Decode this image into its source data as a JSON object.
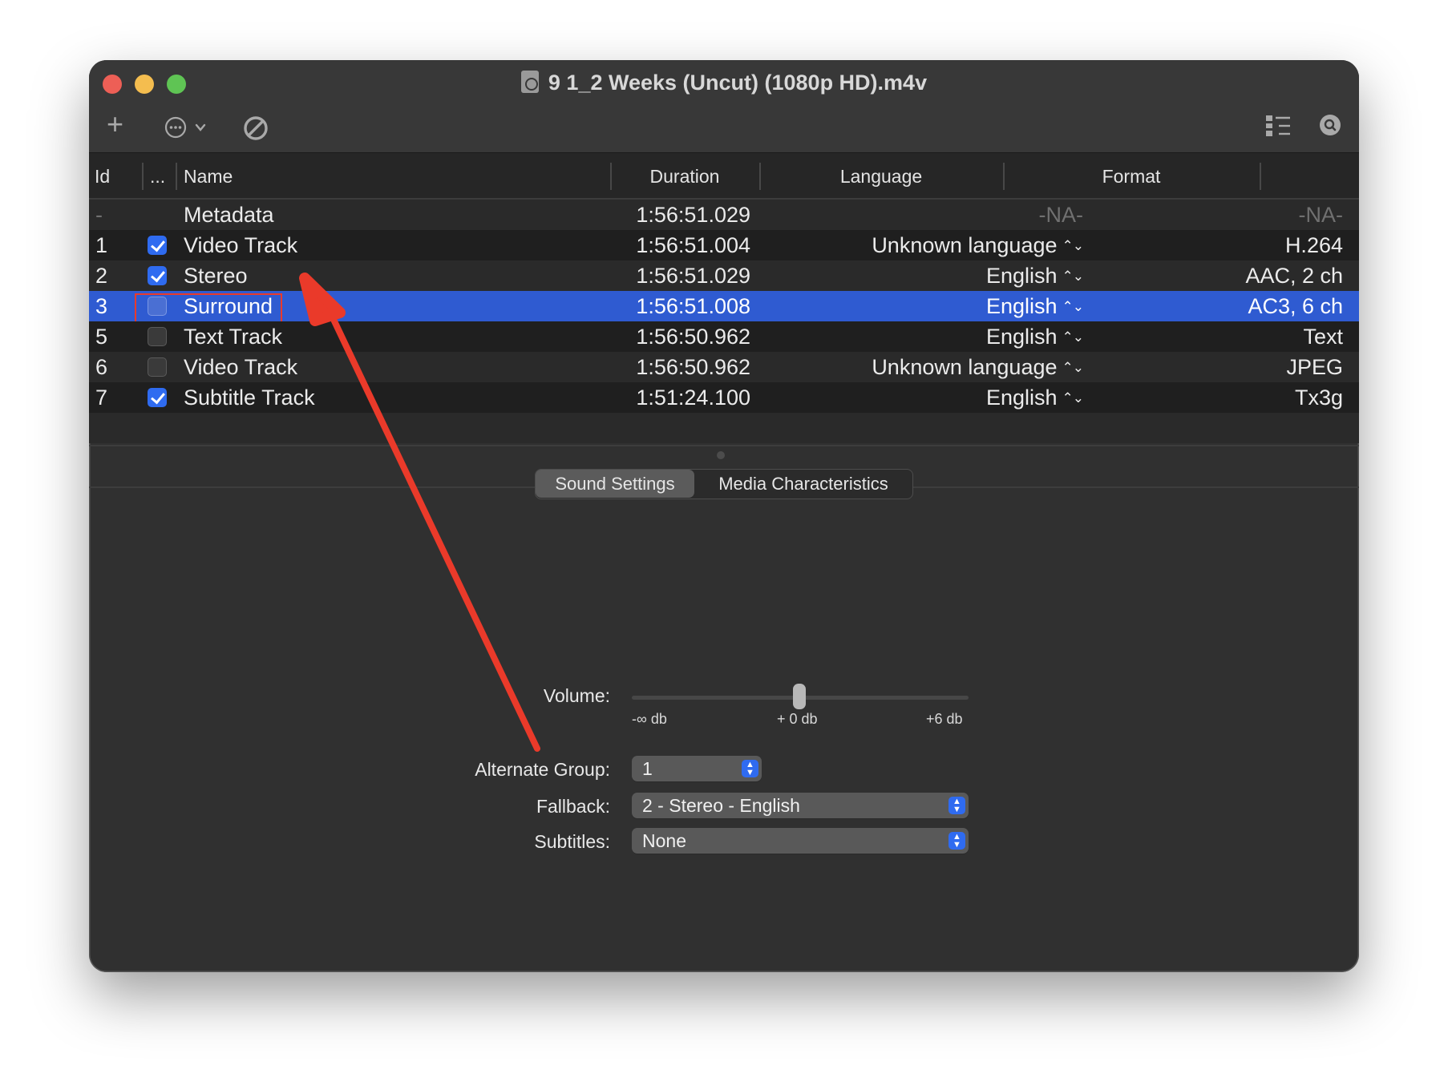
{
  "window": {
    "title": "9 1_2 Weeks (Uncut) (1080p HD).m4v"
  },
  "toolbar": {
    "add_icon": "plus-icon",
    "actions_icon": "ellipsis-circle-icon",
    "disable_icon": "prohibited-icon",
    "view_icon": "list-view-icon",
    "inspect_icon": "magnifier-icon"
  },
  "table": {
    "headers": {
      "id": "Id",
      "enabled": "...",
      "name": "Name",
      "duration": "Duration",
      "language": "Language",
      "format": "Format"
    },
    "rows": [
      {
        "id": "-",
        "checked": null,
        "name": "Metadata",
        "duration": "1:56:51.029",
        "language": "-NA-",
        "format": "-NA-"
      },
      {
        "id": "1",
        "checked": true,
        "name": "Video Track",
        "duration": "1:56:51.004",
        "language": "Unknown language",
        "format": "H.264"
      },
      {
        "id": "2",
        "checked": true,
        "name": "Stereo",
        "duration": "1:56:51.029",
        "language": "English",
        "format": "AAC, 2 ch"
      },
      {
        "id": "3",
        "checked": false,
        "name": "Surround",
        "duration": "1:56:51.008",
        "language": "English",
        "format": "AC3, 6 ch",
        "selected": true
      },
      {
        "id": "5",
        "checked": false,
        "name": "Text Track",
        "duration": "1:56:50.962",
        "language": "English",
        "format": "Text"
      },
      {
        "id": "6",
        "checked": false,
        "name": "Video Track",
        "duration": "1:56:50.962",
        "language": "Unknown language",
        "format": "JPEG"
      },
      {
        "id": "7",
        "checked": true,
        "name": "Subtitle Track",
        "duration": "1:51:24.100",
        "language": "English",
        "format": "Tx3g"
      }
    ]
  },
  "tabs": {
    "sound_settings": "Sound Settings",
    "media_characteristics": "Media Characteristics",
    "active": "Sound Settings"
  },
  "sound": {
    "volume_label": "Volume:",
    "volume_min": "-∞ db",
    "volume_mid": "+ 0 db",
    "volume_max": "+6 db",
    "volume_value_fraction": 0.5,
    "alternate_group_label": "Alternate Group:",
    "alternate_group_value": "1",
    "fallback_label": "Fallback:",
    "fallback_value": "2 - Stereo - English",
    "subtitles_label": "Subtitles:",
    "subtitles_value": "None"
  },
  "colors": {
    "selection": "#2f5bd1",
    "checkbox_on": "#2f6bf0",
    "annotation": "#ea3a2a"
  }
}
